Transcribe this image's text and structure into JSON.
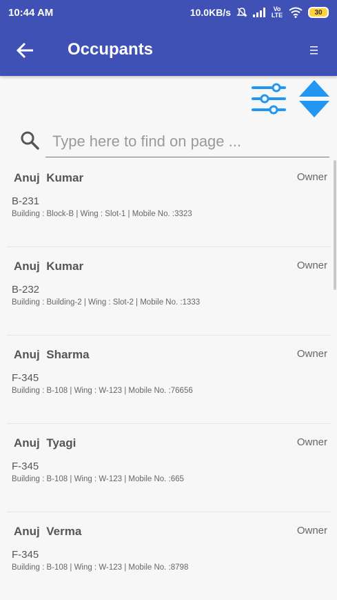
{
  "status_bar": {
    "time": "10:44 AM",
    "network_speed": "10.0KB/s",
    "network_type": "Vo LTE",
    "battery": "30"
  },
  "app_bar": {
    "title": "Occupants"
  },
  "icons": {
    "back": "arrow-left-icon",
    "menu": "hamburger-icon",
    "filter": "sliders-icon",
    "sort": "sort-up-down-icon",
    "search": "search-icon"
  },
  "colors": {
    "primary": "#3f51b5",
    "accent": "#2196f3"
  },
  "search": {
    "placeholder": "Type here to find on page ..."
  },
  "occupants": [
    {
      "first_name": "Anuj",
      "last_name": "Kumar",
      "role": "Owner",
      "unit": "B-231",
      "details": "Building : Block-B | Wing : Slot-1 | Mobile No. :3323"
    },
    {
      "first_name": "Anuj",
      "last_name": "Kumar",
      "role": "Owner",
      "unit": "B-232",
      "details": "Building : Building-2 | Wing : Slot-2 | Mobile No. :1333"
    },
    {
      "first_name": "Anuj",
      "last_name": "Sharma",
      "role": "Owner",
      "unit": "F-345",
      "details": "Building : B-108 | Wing : W-123 | Mobile No. :76656"
    },
    {
      "first_name": "Anuj",
      "last_name": "Tyagi",
      "role": "Owner",
      "unit": "F-345",
      "details": "Building : B-108 | Wing : W-123 | Mobile No. :665"
    },
    {
      "first_name": "Anuj",
      "last_name": "Verma",
      "role": "Owner",
      "unit": "F-345",
      "details": "Building : B-108 | Wing : W-123 | Mobile No. :8798"
    }
  ]
}
